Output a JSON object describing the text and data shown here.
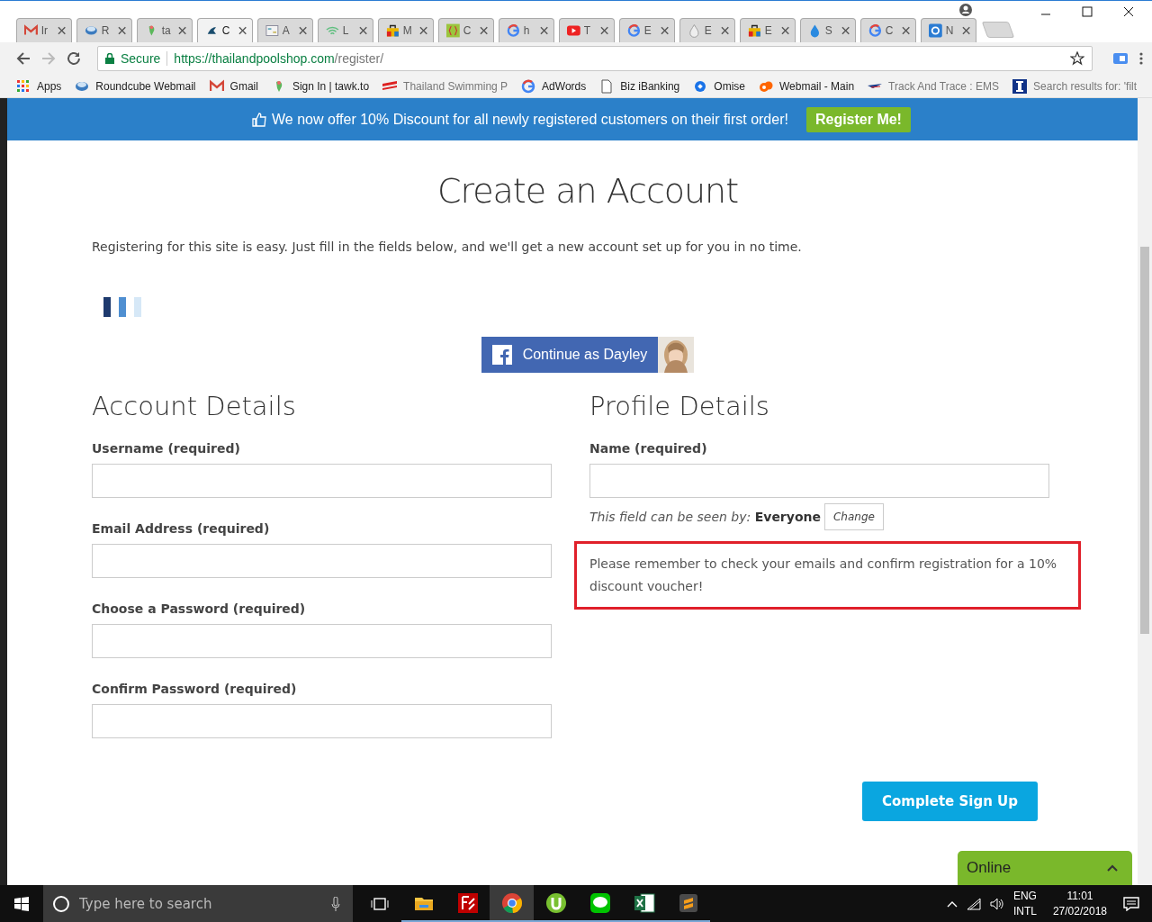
{
  "tabs": [
    {
      "label": "Ir",
      "selected": false
    },
    {
      "label": "R",
      "selected": false
    },
    {
      "label": "ta",
      "selected": false
    },
    {
      "label": "C",
      "selected": true
    },
    {
      "label": "A",
      "selected": false
    },
    {
      "label": "L",
      "selected": false
    },
    {
      "label": "M",
      "selected": false
    },
    {
      "label": "C",
      "selected": false
    },
    {
      "label": "h",
      "selected": false
    },
    {
      "label": "T",
      "selected": false
    },
    {
      "label": "E",
      "selected": false
    },
    {
      "label": "E",
      "selected": false
    },
    {
      "label": "E",
      "selected": false
    },
    {
      "label": "S",
      "selected": false
    },
    {
      "label": "C",
      "selected": false
    },
    {
      "label": "N",
      "selected": false
    }
  ],
  "address_bar": {
    "security": "Secure",
    "url_host": "https://thailandpoolshop.com",
    "url_path": "/register/"
  },
  "bookmarks": [
    {
      "label": "Apps",
      "faded": false
    },
    {
      "label": "Roundcube Webmail",
      "faded": false
    },
    {
      "label": "Gmail",
      "faded": false
    },
    {
      "label": "Sign In | tawk.to",
      "faded": false
    },
    {
      "label": "Thailand Swimming P",
      "faded": true
    },
    {
      "label": "AdWords",
      "faded": false
    },
    {
      "label": "Biz iBanking",
      "faded": false
    },
    {
      "label": "Omise",
      "faded": false
    },
    {
      "label": "Webmail - Main",
      "faded": false
    },
    {
      "label": "Track And Trace : EMS",
      "faded": true
    },
    {
      "label": "Search results for: 'filt",
      "faded": true
    }
  ],
  "banner": {
    "text": "We now offer 10% Discount for all newly registered customers on their first order!",
    "button": "Register Me!"
  },
  "page": {
    "title": "Create an Account",
    "intro": "Registering for this site is easy. Just fill in the fields below, and we'll get a new account set up for you in no time.",
    "facebook_button": "Continue as Dayley"
  },
  "account_details": {
    "heading": "Account Details",
    "fields": [
      {
        "label": "Username (required)"
      },
      {
        "label": "Email Address (required)"
      },
      {
        "label": "Choose a Password (required)"
      },
      {
        "label": "Confirm Password (required)"
      }
    ]
  },
  "profile_details": {
    "heading": "Profile Details",
    "fields": [
      {
        "label": "Name (required)"
      }
    ],
    "visibility_prefix": "This field can be seen by:",
    "visibility_value": "Everyone",
    "change_button": "Change",
    "notice": "Please remember to check your emails and confirm registration for a 10% discount voucher!"
  },
  "submit_button": "Complete Sign Up",
  "chat_widget": {
    "status": "Online",
    "expanded": false
  },
  "taskbar": {
    "search_placeholder": "Type here to search",
    "apps": [
      {
        "selected": false
      },
      {
        "selected": false
      },
      {
        "selected": true
      },
      {
        "selected": false
      },
      {
        "selected": false
      },
      {
        "selected": false
      },
      {
        "selected": false
      }
    ],
    "language": "ENG",
    "layout": "INTL",
    "time": "11:01",
    "date": "27/02/2018"
  }
}
